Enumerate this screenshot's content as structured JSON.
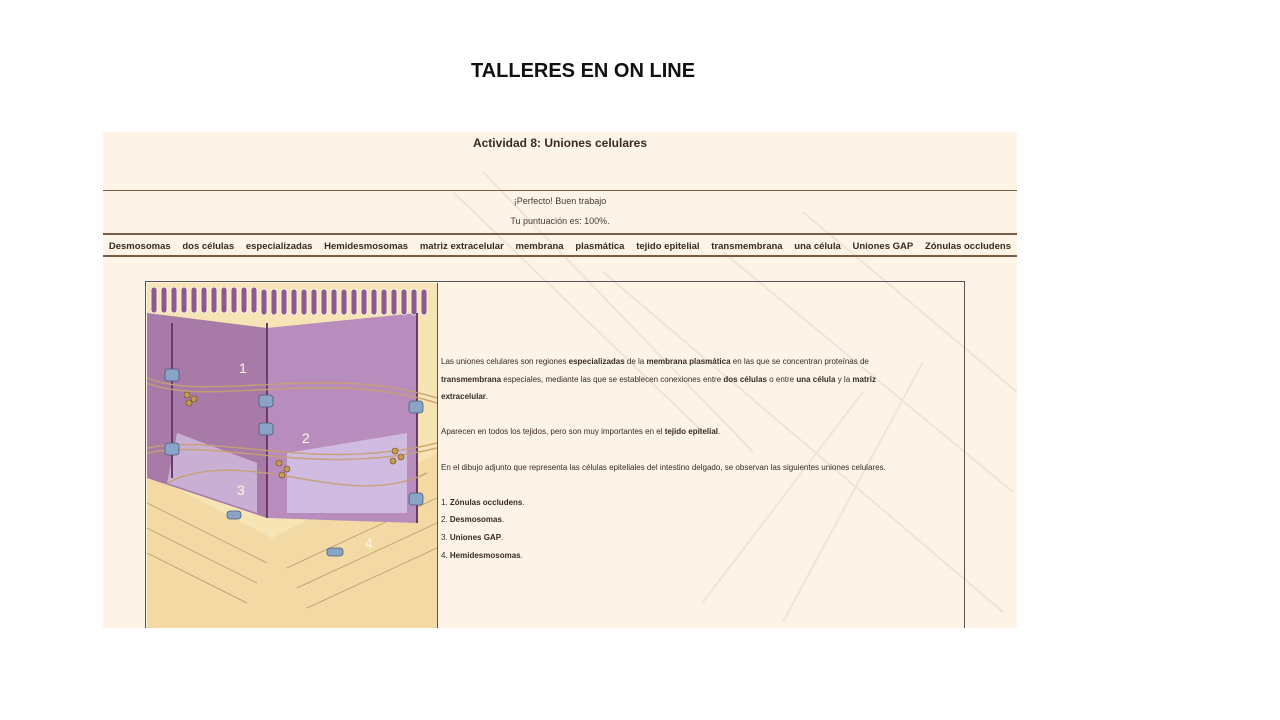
{
  "slide": {
    "title": "TALLERES EN ON LINE"
  },
  "activity": {
    "title": "Actividad 8: Uniones celulares",
    "feedback": "¡Perfecto! Buen trabajo",
    "score": "Tu puntuación es: 100%."
  },
  "words": [
    "Desmosomas",
    "dos células",
    "especializadas",
    "Hemidesmosomas",
    "matriz extracelular",
    "membrana",
    "plasmática",
    "tejido epitelial",
    "transmembrana",
    "una célula",
    "Uniones GAP",
    "Zónulas occludens"
  ],
  "text": {
    "p1a": "Las uniones celulares son regiones ",
    "p1b": "especializadas",
    "p1c": " de la ",
    "p1d": "membrana plasmática",
    "p1e": " en las que se concentran proteínas de",
    "p1f": "transmembrana",
    "p1g": " especiales, mediante las que se establecen conexiones entre ",
    "p1h": "dos células",
    "p1i": " o entre ",
    "p1j": "una célula",
    "p1k": " y la ",
    "p1l": "matriz",
    "p1m": "extracelular",
    "p1n": ".",
    "p2a": "Aparecen en todos los tejidos, pero son muy importantes en el ",
    "p2b": "tejido epitelial",
    "p2c": ".",
    "p3": "En el dibujo adjunto que representa las células epiteliales del intestino delgado, se observan las siguientes uniones celulares.",
    "l1a": "1. ",
    "l1b": "Zónulas occludens",
    "l1c": ".",
    "l2a": "2. ",
    "l2b": "Desmosomas",
    "l2c": ".",
    "l3a": "3. ",
    "l3b": "Uniones GAP",
    "l3c": ".",
    "l4a": "4. ",
    "l4b": "Hemidesmosomas",
    "l4c": "."
  },
  "illustration": {
    "labels": [
      "1",
      "2",
      "3",
      "4"
    ]
  }
}
